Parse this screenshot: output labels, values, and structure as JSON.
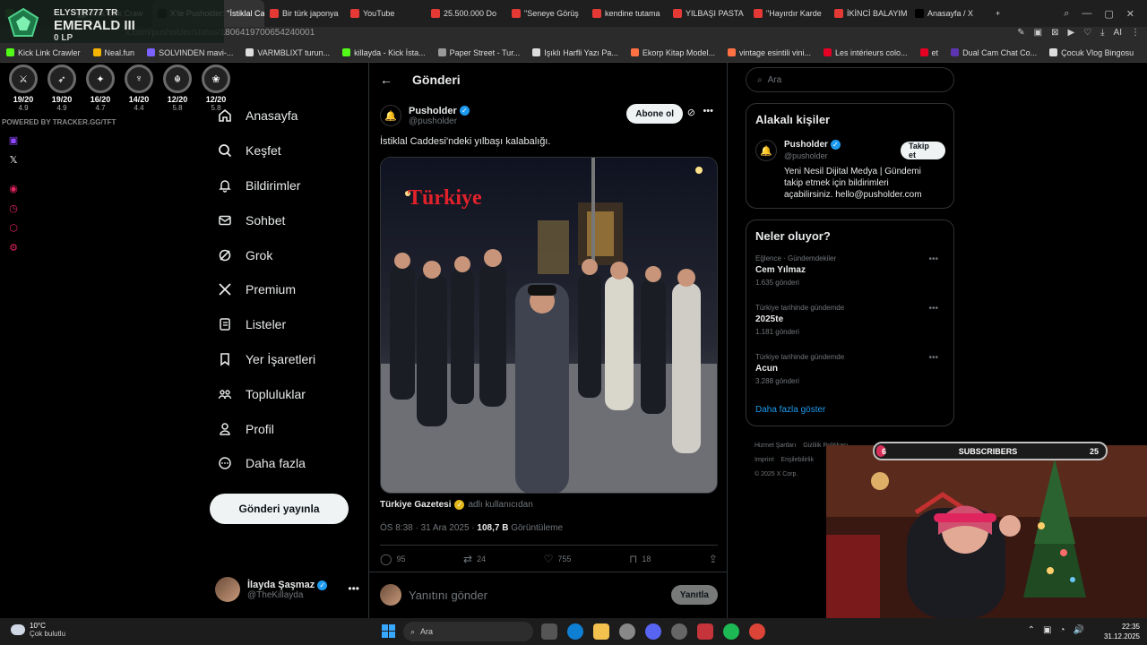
{
  "browser": {
    "tabs": [
      {
        "label": "",
        "color": "#2e7d32"
      },
      {
        "label": "Kick Link Craw",
        "color": "#777"
      },
      {
        "label": "X'te Pusholder: \"İstiklal Ca",
        "color": "#000",
        "active": true
      },
      {
        "label": "Bir türk japonya",
        "color": "#e53935"
      },
      {
        "label": "YouTube",
        "color": "#e53935"
      },
      {
        "label": "25.500.000 Do",
        "color": "#e53935"
      },
      {
        "label": "\"Seneye Görüş",
        "color": "#e53935"
      },
      {
        "label": "kendine tutama",
        "color": "#e53935"
      },
      {
        "label": "YILBAŞI PASTA",
        "color": "#e53935"
      },
      {
        "label": "\"Hayırdır Karde",
        "color": "#e53935"
      },
      {
        "label": "İKİNCİ BALAYIM",
        "color": "#e53935"
      },
      {
        "label": "Anasayfa / X",
        "color": "#000"
      }
    ],
    "url": "x.com/pusholder/status/1806419700654240001",
    "bookmarks": [
      {
        "label": "Kick Link Crawler",
        "color": "#53fc18"
      },
      {
        "label": "Neal.fun",
        "color": "#f4b400"
      },
      {
        "label": "SOLVINDEN mavi-...",
        "color": "#7b61ff"
      },
      {
        "label": "VARMBLIXT turun...",
        "color": "#ddd"
      },
      {
        "label": "killayda - Kick İsta...",
        "color": "#53fc18"
      },
      {
        "label": "Paper Street - Tur...",
        "color": "#999"
      },
      {
        "label": "Işıklı Harfli Yazı Pa...",
        "color": "#ddd"
      },
      {
        "label": "Ekorp Kitap Model...",
        "color": "#ff7043"
      },
      {
        "label": "vintage esintili vini...",
        "color": "#ff7043"
      },
      {
        "label": "Les intérieurs colo...",
        "color": "#e60023"
      },
      {
        "label": "et",
        "color": "#e60023"
      },
      {
        "label": "Dual Cam Chat Co...",
        "color": "#5e35b1"
      },
      {
        "label": "Çocuk Vlog Bingosu",
        "color": "#ddd"
      }
    ]
  },
  "tft": {
    "player": "ELYSTR777 TR",
    "rank": "EMERALD III",
    "lp": "0 LP",
    "games": [
      {
        "glyph": "⚔",
        "score": "19/20",
        "avg": "4.9"
      },
      {
        "glyph": "➶",
        "score": "19/20",
        "avg": "4.9"
      },
      {
        "glyph": "✦",
        "score": "16/20",
        "avg": "4.7"
      },
      {
        "glyph": "♆",
        "score": "14/20",
        "avg": "4.4"
      },
      {
        "glyph": "☬",
        "score": "12/20",
        "avg": "5.8"
      },
      {
        "glyph": "❀",
        "score": "12/20",
        "avg": "5.8"
      }
    ],
    "powered": "POWERED BY TRACKER.GG/TFT"
  },
  "nav": {
    "items": [
      {
        "label": "Anasayfa",
        "icon": "home-icon"
      },
      {
        "label": "Keşfet",
        "icon": "search-icon"
      },
      {
        "label": "Bildirimler",
        "icon": "bell-icon"
      },
      {
        "label": "Sohbet",
        "icon": "mail-icon"
      },
      {
        "label": "Grok",
        "icon": "grok-icon"
      },
      {
        "label": "Premium",
        "icon": "x-logo-icon"
      },
      {
        "label": "Listeler",
        "icon": "list-icon"
      },
      {
        "label": "Yer İşaretleri",
        "icon": "bookmark-icon"
      },
      {
        "label": "Topluluklar",
        "icon": "people-icon"
      },
      {
        "label": "Profil",
        "icon": "person-icon"
      },
      {
        "label": "Daha fazla",
        "icon": "more-circle-icon"
      }
    ],
    "post_button": "Gönderi yayınla",
    "account": {
      "name": "İlayda Şaşmaz",
      "handle": "@TheKillayda"
    }
  },
  "main": {
    "header_title": "Gönderi",
    "author": {
      "name": "Pusholder",
      "handle": "@pusholder"
    },
    "subscribe_label": "Abone ol",
    "text": "İstiklal Caddesi'ndeki yılbaşı kalabalığı.",
    "media_overlay": "Türkiye",
    "source_name": "Türkiye Gazetesi",
    "source_suffix": "adlı kullanıcıdan",
    "time": "ÖS 8:38 · 31 Ara 2025 · ",
    "views_count": "108,7 B",
    "views_label": " Görüntüleme",
    "stats": {
      "replies": "95",
      "reposts": "24",
      "likes": "755",
      "bookmarks": "18"
    },
    "reply_placeholder": "Yanıtını gönder",
    "reply_button": "Yanıtla"
  },
  "right": {
    "search_placeholder": "Ara",
    "related_title": "Alakalı kişiler",
    "related_user": {
      "name": "Pusholder",
      "handle": "@pusholder",
      "bio": "Yeni Nesil Dijital Medya | Gündemi takip etmek için bildirimleri açabilirsiniz. hello@pusholder.com",
      "follow_label": "Takip et"
    },
    "trends_title": "Neler oluyor?",
    "trends": [
      {
        "category": "Eğlence · Gündemdekiler",
        "name": "Cem Yılmaz",
        "count": "1.635 gönderi"
      },
      {
        "category": "Türkiye tarihinde gündemde",
        "name": "2025te",
        "count": "1.181 gönderi"
      },
      {
        "category": "Türkiye tarihinde gündemde",
        "name": "Acun",
        "count": "3.288 gönderi"
      }
    ],
    "show_more": "Daha fazla göster",
    "footer": [
      "Hizmet Şartları",
      "Gizlilik Politikası",
      "Imprint",
      "Erişilebilirlik",
      "© 2025 X Corp."
    ]
  },
  "overlay": {
    "subs_current": "6",
    "subs_label": "SUBSCRIBERS",
    "subs_goal": "25",
    "subs_progress": 0.24
  },
  "taskbar": {
    "temp": "10°C",
    "weather": "Çok bulutlu",
    "search": "Ara",
    "time": "22:35",
    "date": "31.12.2025"
  },
  "colors": {
    "accent": "#1d9bf0",
    "verified_gold": "#e2b719",
    "subs_bar": "#d6305a"
  }
}
